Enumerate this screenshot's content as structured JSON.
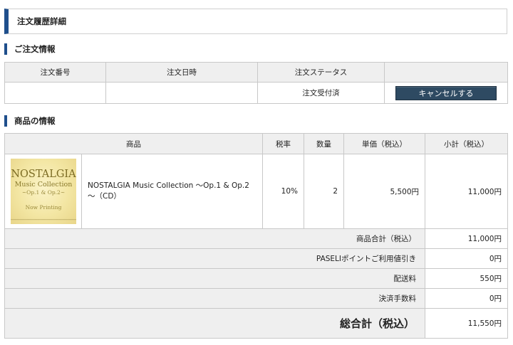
{
  "header": {
    "title": "注文履歴詳細"
  },
  "order_section": {
    "title": "ご注文情報",
    "columns": [
      "注文番号",
      "注文日時",
      "注文ステータス",
      ""
    ],
    "row": {
      "order_number": "",
      "order_date": "",
      "status": "注文受付済"
    },
    "cancel_label": "キャンセルする"
  },
  "items_section": {
    "title": "商品の情報",
    "columns": {
      "product": "商品",
      "tax": "税率",
      "qty": "数量",
      "unit": "単価（税込）",
      "subtotal": "小計（税込）"
    },
    "items": [
      {
        "image": {
          "title": "NOSTALGIA",
          "subtitle": "Music Collection",
          "op": "~Op.1 & Op.2~",
          "now_printing": "Now Printing"
        },
        "name": "NOSTALGIA Music Collection ～Op.1 & Op.2～（CD）",
        "tax": "10%",
        "qty": "2",
        "unit_price": "5,500円",
        "subtotal": "11,000円"
      }
    ],
    "summary": [
      {
        "label": "商品合計（税込）",
        "value": "11,000円"
      },
      {
        "label": "PASELIポイントご利用値引き",
        "value": "0円"
      },
      {
        "label": "配送料",
        "value": "550円"
      },
      {
        "label": "決済手数料",
        "value": "0円"
      }
    ],
    "grand_total": {
      "label": "総合計（税込）",
      "value": "11,550円"
    }
  },
  "colors": {
    "accent": "#1f4f8c",
    "button": "#2e4a62",
    "header_bg": "#efefef",
    "border": "#c8c8c8"
  }
}
